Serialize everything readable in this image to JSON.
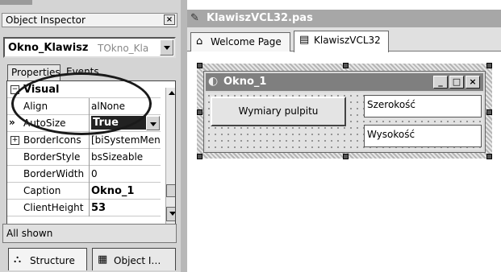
{
  "inspector": {
    "title": "Object Inspector",
    "close_glyph": "×",
    "object_name": "Okno_Klawisz",
    "object_class": "TOkno_Kla",
    "tabs": [
      "Properties",
      "Events"
    ],
    "rows": [
      {
        "key": "Visual",
        "value": "",
        "expander": "−",
        "bold": true
      },
      {
        "key": "Align",
        "value": "alNone",
        "expander": "",
        "bold": false
      },
      {
        "key": "AutoSize",
        "value": "True",
        "expander": "»",
        "bold": false
      },
      {
        "key": "BorderIcons",
        "value": "[biSystemMen",
        "expander": "+",
        "bold": false
      },
      {
        "key": "BorderStyle",
        "value": "bsSizeable",
        "expander": "",
        "bold": false
      },
      {
        "key": "BorderWidth",
        "value": "0",
        "expander": "",
        "bold": false
      },
      {
        "key": "Caption",
        "value": "Okno_1",
        "expander": "",
        "bold": false
      },
      {
        "key": "ClientHeight",
        "value": "53",
        "expander": "",
        "bold": false
      }
    ],
    "status": "All shown",
    "bottom_tabs": [
      {
        "label": "Structure",
        "icon": "structure-icon"
      },
      {
        "label": "Object I…",
        "icon": "object-inspector-icon"
      }
    ]
  },
  "editor": {
    "title": "KlawiszVCL32.pas",
    "tabs": [
      {
        "label": "Welcome Page",
        "icon": "home-icon"
      },
      {
        "label": "KlawiszVCL32",
        "icon": "form-file-icon"
      }
    ],
    "form": {
      "caption": "Okno_1",
      "button_label": "Wymiary pulpitu",
      "label_width": "Szerokość",
      "label_height": "Wysokość",
      "caption_buttons": [
        "_",
        "□",
        "×"
      ]
    }
  }
}
